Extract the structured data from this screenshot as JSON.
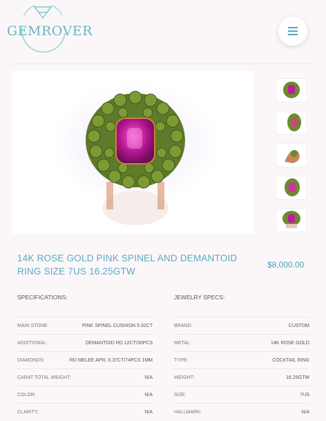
{
  "header": {
    "brand": "GEMROVER",
    "menu_icon": "hamburger-icon",
    "accent": "#6ab4c8"
  },
  "product": {
    "title": "14K ROSE GOLD PINK SPINEL AND DEMANTOID RING SIZE 7US 16.25gTW",
    "price": "$8,000.00"
  },
  "specifications": {
    "heading": "SPECIFICATIONS:",
    "rows": [
      {
        "label": "MAIN STONE:",
        "value": "PINK SPINEL CUSHION 5.32CT"
      },
      {
        "label": "ADDITIONAL:",
        "value": "DEMANTOID RD 12CT/30PCS"
      },
      {
        "label": "DIAMONDS:",
        "value": "RD MELEE APR. 0.37CT/74PCS 1MM"
      },
      {
        "label": "CARAT TOTAL WEIGHT:",
        "value": "N/A"
      },
      {
        "label": "COLOR:",
        "value": "N/A"
      },
      {
        "label": "CLARITY:",
        "value": "N/A"
      }
    ]
  },
  "jewelry_specs": {
    "heading": "JEWELRY SPECS:",
    "rows": [
      {
        "label": "BRAND:",
        "value": "CUSTOM"
      },
      {
        "label": "METAL:",
        "value": "14K ROSE GOLD"
      },
      {
        "label": "TYPE:",
        "value": "COCKTAIL RING"
      },
      {
        "label": "WEIGHT:",
        "value": "16.25GTW"
      },
      {
        "label": "SIZE:",
        "value": "7US"
      },
      {
        "label": "HALLMARK:",
        "value": "N/A"
      }
    ]
  }
}
